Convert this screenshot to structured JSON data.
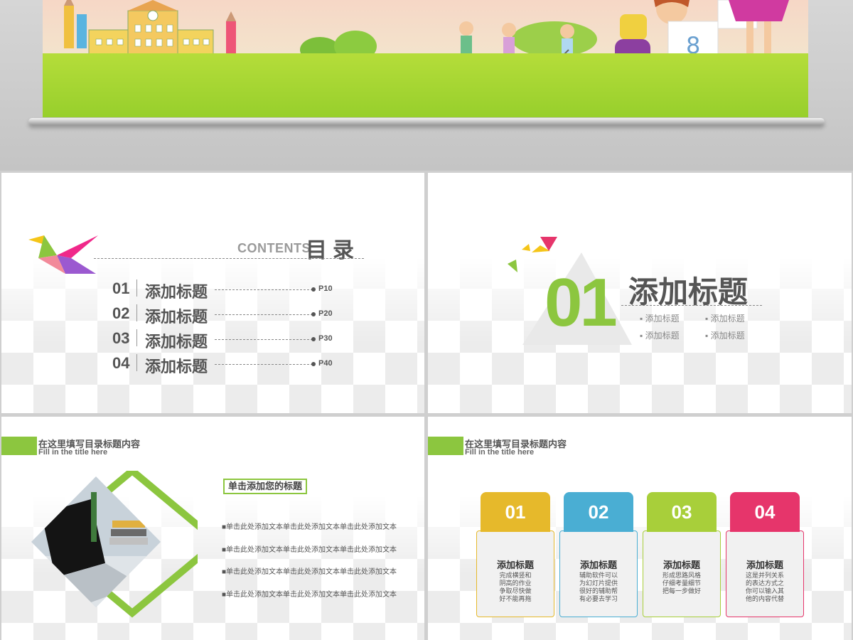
{
  "colors": {
    "accent_green": "#8cc63f",
    "card_yellow": "#e6b92b",
    "card_blue": "#4aaed3",
    "card_green": "#a8cf3a",
    "card_pink": "#e6356b",
    "text_dark": "#555555"
  },
  "toc": {
    "contents_word": "CONTENTS",
    "title": "目录",
    "items": [
      {
        "num": "01",
        "label": "添加标题",
        "page": "P10"
      },
      {
        "num": "02",
        "label": "添加标题",
        "page": "P20"
      },
      {
        "num": "03",
        "label": "添加标题",
        "page": "P30"
      },
      {
        "num": "04",
        "label": "添加标题",
        "page": "P40"
      }
    ]
  },
  "section": {
    "number": "01",
    "title": "添加标题",
    "bullets": [
      "添加标题",
      "添加标题",
      "添加标题",
      "添加标题"
    ]
  },
  "header": {
    "zh": "在这里填写目录标题内容",
    "en": "Fill in the title here"
  },
  "slide3": {
    "box_title": "单击添加您的标题",
    "lines": [
      "■单击此处添加文本单击此处添加文本单击此处添加文本",
      "■单击此处添加文本单击此处添加文本单击此处添加文本",
      "■单击此处添加文本单击此处添加文本单击此处添加文本",
      "■单击此处添加文本单击此处添加文本单击此处添加文本"
    ]
  },
  "cards": [
    {
      "num": "01",
      "title": "添加标题",
      "text": "完成横竖和\n阴高的作业\n争取尽快做\n好不能再拖"
    },
    {
      "num": "02",
      "title": "添加标题",
      "text": "辅助软件可以\n为幻灯片提供\n很好的辅助帮\n有必要去学习"
    },
    {
      "num": "03",
      "title": "添加标题",
      "text": "形成思路风格\n仔细考量细节\n把每一步做好"
    },
    {
      "num": "04",
      "title": "添加标题",
      "text": "这是并列关系\n的表达方式之\n你可以输入其\n他的内容代替"
    }
  ]
}
